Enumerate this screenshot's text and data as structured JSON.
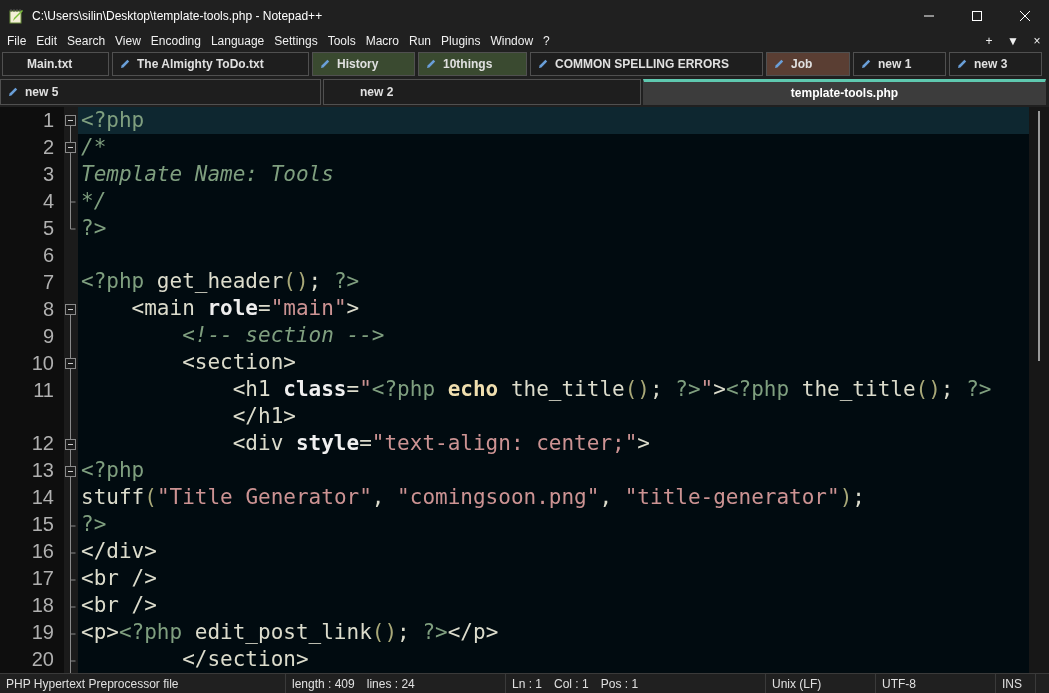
{
  "window": {
    "title": "C:\\Users\\silin\\Desktop\\template-tools.php - Notepad++"
  },
  "menu": [
    "File",
    "Edit",
    "Search",
    "View",
    "Encoding",
    "Language",
    "Settings",
    "Tools",
    "Macro",
    "Run",
    "Plugins",
    "Window",
    "?"
  ],
  "menu_right": [
    "+",
    "▼",
    "×"
  ],
  "tab_rows": [
    [
      {
        "label": "Main.txt",
        "modified": false,
        "color": "#1e1e1e",
        "selected": false
      },
      {
        "label": "The Almighty ToDo.txt",
        "modified": true,
        "color": "#1e1e1e",
        "selected": false
      },
      {
        "label": "History",
        "modified": true,
        "color": "#3a4a30",
        "selected": false
      },
      {
        "label": "10things",
        "modified": true,
        "color": "#3a4a30",
        "selected": false
      },
      {
        "label": "COMMON SPELLING ERRORS",
        "modified": true,
        "color": "#1e1e1e",
        "selected": false
      },
      {
        "label": "Job",
        "modified": true,
        "color": "#5a3e33",
        "selected": false
      },
      {
        "label": "new 1",
        "modified": true,
        "color": "#1e1e1e",
        "selected": false
      },
      {
        "label": "new 3",
        "modified": true,
        "color": "#1e1e1e",
        "selected": false
      }
    ],
    [
      {
        "label": "new 5",
        "modified": true,
        "color": "#1e1e1e",
        "selected": false
      },
      {
        "label": "new 2",
        "modified": false,
        "color": "#1e1e1e",
        "selected": false
      },
      {
        "label": "template-tools.php",
        "modified": false,
        "color": "#3c3c3c",
        "selected": true
      }
    ]
  ],
  "lines": [
    {
      "number": "1",
      "kind": "open",
      "current": true,
      "rows": [
        [
          {
            "kind": "php",
            "text": "<?php"
          }
        ]
      ]
    },
    {
      "number": "2",
      "kind": "open",
      "current": false,
      "rows": [
        [
          {
            "kind": "comment",
            "text": "/*"
          }
        ]
      ]
    },
    {
      "number": "3",
      "kind": "body",
      "current": false,
      "rows": [
        [
          {
            "kind": "comment",
            "text": "Template Name: Tools"
          }
        ]
      ]
    },
    {
      "number": "4",
      "kind": "end",
      "current": false,
      "rows": [
        [
          {
            "kind": "comment",
            "text": "*/"
          }
        ]
      ]
    },
    {
      "number": "5",
      "kind": "last",
      "current": false,
      "rows": [
        [
          {
            "kind": "php",
            "text": "?>"
          }
        ]
      ]
    },
    {
      "number": "6",
      "kind": "plain",
      "current": false,
      "rows": [
        []
      ]
    },
    {
      "number": "7",
      "kind": "plain",
      "current": false,
      "rows": [
        [
          {
            "kind": "php",
            "text": "<?php"
          },
          {
            "kind": "text",
            "text": " get_header"
          },
          {
            "kind": "paren",
            "text": "()"
          },
          {
            "kind": "text",
            "text": "; "
          },
          {
            "kind": "php",
            "text": "?>"
          }
        ]
      ]
    },
    {
      "number": "8",
      "kind": "open",
      "current": false,
      "rows": [
        [
          {
            "kind": "tag",
            "text": "    <main "
          },
          {
            "kind": "attr",
            "text": "role"
          },
          {
            "kind": "tag",
            "text": "="
          },
          {
            "kind": "str",
            "text": "\"main\""
          },
          {
            "kind": "tag",
            "text": ">"
          }
        ]
      ]
    },
    {
      "number": "9",
      "kind": "body",
      "current": false,
      "rows": [
        [
          {
            "kind": "comment",
            "text": "        <!-- section -->"
          }
        ]
      ]
    },
    {
      "number": "10",
      "kind": "open",
      "current": false,
      "rows": [
        [
          {
            "kind": "tag",
            "text": "        <section>"
          }
        ]
      ]
    },
    {
      "number": "11",
      "kind": "body",
      "current": false,
      "rows": [
        [
          {
            "kind": "tag",
            "text": "            <h1 "
          },
          {
            "kind": "attr",
            "text": "class"
          },
          {
            "kind": "tag",
            "text": "="
          },
          {
            "kind": "str",
            "text": "\""
          },
          {
            "kind": "php",
            "text": "<?php "
          },
          {
            "kind": "kw",
            "text": "echo"
          },
          {
            "kind": "text",
            "text": " the_title"
          },
          {
            "kind": "paren",
            "text": "()"
          },
          {
            "kind": "text",
            "text": "; "
          },
          {
            "kind": "php",
            "text": "?>"
          },
          {
            "kind": "str",
            "text": "\""
          },
          {
            "kind": "tag",
            "text": ">"
          },
          {
            "kind": "php",
            "text": "<?php"
          },
          {
            "kind": "text",
            "text": " the_title"
          },
          {
            "kind": "paren",
            "text": "()"
          },
          {
            "kind": "text",
            "text": "; "
          },
          {
            "kind": "php",
            "text": "?>"
          }
        ],
        [
          {
            "kind": "tag",
            "text": "            </h1>"
          }
        ]
      ]
    },
    {
      "number": "12",
      "kind": "open",
      "current": false,
      "rows": [
        [
          {
            "kind": "tag",
            "text": "            <div "
          },
          {
            "kind": "attr",
            "text": "style"
          },
          {
            "kind": "tag",
            "text": "="
          },
          {
            "kind": "str",
            "text": "\"text-align: center;\""
          },
          {
            "kind": "tag",
            "text": ">"
          }
        ]
      ]
    },
    {
      "number": "13",
      "kind": "open",
      "current": false,
      "rows": [
        [
          {
            "kind": "php",
            "text": "<?php"
          }
        ]
      ]
    },
    {
      "number": "14",
      "kind": "body",
      "current": false,
      "rows": [
        [
          {
            "kind": "text",
            "text": "stuff"
          },
          {
            "kind": "paren",
            "text": "("
          },
          {
            "kind": "str",
            "text": "\"Title Generator\""
          },
          {
            "kind": "text",
            "text": ", "
          },
          {
            "kind": "str",
            "text": "\"comingsoon.png\""
          },
          {
            "kind": "text",
            "text": ", "
          },
          {
            "kind": "str",
            "text": "\"title-generator\""
          },
          {
            "kind": "paren",
            "text": ")"
          },
          {
            "kind": "text",
            "text": ";"
          }
        ]
      ]
    },
    {
      "number": "15",
      "kind": "end",
      "current": false,
      "rows": [
        [
          {
            "kind": "php",
            "text": "?>"
          }
        ]
      ]
    },
    {
      "number": "16",
      "kind": "end",
      "current": false,
      "rows": [
        [
          {
            "kind": "tag",
            "text": "</div>"
          }
        ]
      ]
    },
    {
      "number": "17",
      "kind": "end",
      "current": false,
      "rows": [
        [
          {
            "kind": "tag",
            "text": "<br />"
          }
        ]
      ]
    },
    {
      "number": "18",
      "kind": "end",
      "current": false,
      "rows": [
        [
          {
            "kind": "tag",
            "text": "<br />"
          }
        ]
      ]
    },
    {
      "number": "19",
      "kind": "end",
      "current": false,
      "rows": [
        [
          {
            "kind": "tag",
            "text": "<p>"
          },
          {
            "kind": "php",
            "text": "<?php"
          },
          {
            "kind": "text",
            "text": " edit_post_link"
          },
          {
            "kind": "paren",
            "text": "()"
          },
          {
            "kind": "text",
            "text": "; "
          },
          {
            "kind": "php",
            "text": "?>"
          },
          {
            "kind": "tag",
            "text": "</p>"
          }
        ]
      ]
    },
    {
      "number": "20",
      "kind": "end",
      "current": false,
      "rows": [
        [
          {
            "kind": "tag",
            "text": "        </section>"
          }
        ]
      ]
    }
  ],
  "status_bar": {
    "file_type": "PHP Hypertext Preprocessor file",
    "length": "length : 409",
    "lines": "lines : 24",
    "ln": "Ln : 1",
    "col": "Col : 1",
    "pos": "Pos : 1",
    "eol": "Unix (LF)",
    "encoding": "UTF-8",
    "mode": "INS"
  }
}
